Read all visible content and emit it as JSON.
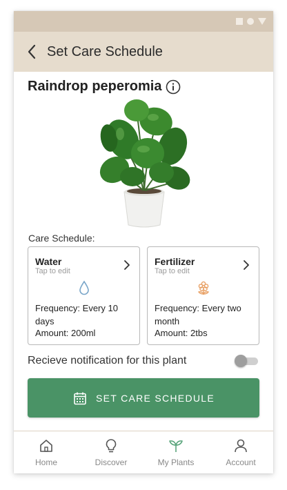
{
  "app_bar": {
    "title": "Set Care Schedule",
    "back_icon": "chevron-left-icon"
  },
  "plant": {
    "name": "Raindrop peperomia",
    "info_icon": "info-icon"
  },
  "care": {
    "label": "Care Schedule:",
    "cards": [
      {
        "title": "Water",
        "subtitle": "Tap to edit",
        "icon": "water-drop-icon",
        "icon_color": "#7aa6c9",
        "frequency": "Frequency: Every 10 days",
        "amount": "Amount: 200ml"
      },
      {
        "title": "Fertilizer",
        "subtitle": "Tap to edit",
        "icon": "flower-icon",
        "icon_color": "#e8a064",
        "frequency": "Frequency: Every two month",
        "amount": "Amount: 2tbs"
      }
    ]
  },
  "notification": {
    "label": "Recieve notification for this plant",
    "enabled": false
  },
  "cta": {
    "label": "SET CARE SCHEDULE",
    "icon": "calendar-icon"
  },
  "nav": {
    "items": [
      {
        "label": "Home",
        "icon": "home-icon",
        "active": false
      },
      {
        "label": "Discover",
        "icon": "lightbulb-icon",
        "active": false
      },
      {
        "label": "My Plants",
        "icon": "sprout-icon",
        "active": true
      },
      {
        "label": "Account",
        "icon": "person-icon",
        "active": false
      }
    ]
  },
  "colors": {
    "status_bar": "#d6c8b6",
    "app_bar": "#e6dccd",
    "accent_green": "#4a9366",
    "active_nav": "#5aa57c"
  }
}
